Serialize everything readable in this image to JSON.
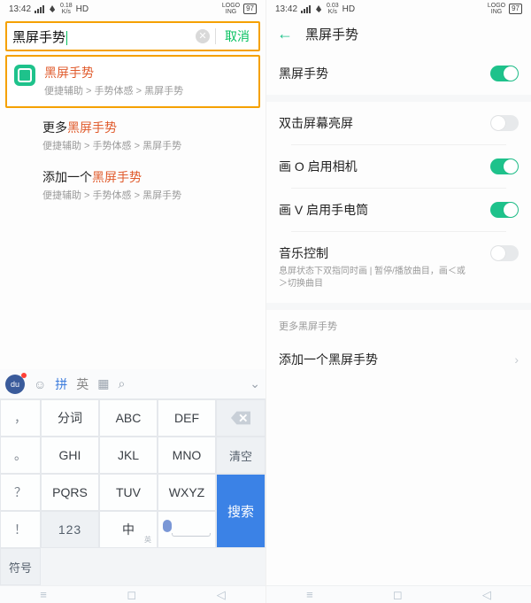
{
  "status": {
    "time": "13:42",
    "net_up": "0.18",
    "net_dn": "K/s",
    "hd": "HD",
    "logo": "LOGO\nING",
    "batt": "97",
    "net_up2": "0.03",
    "net_dn2": "K/s"
  },
  "search": {
    "query": "黑屏手势",
    "cancel": "取消",
    "clear_glyph": "✕"
  },
  "results": [
    {
      "title_pre": "",
      "title_hl": "黑屏手势",
      "title_post": "",
      "path": "便捷辅助 > 手势体感 > 黑屏手势",
      "selected": true,
      "icon": true
    },
    {
      "title_pre": "更多",
      "title_hl": "黑屏手势",
      "title_post": "",
      "path": "便捷辅助 > 手势体感 > 黑屏手势",
      "selected": false,
      "icon": false
    },
    {
      "title_pre": "添加一个",
      "title_hl": "黑屏手势",
      "title_post": "",
      "path": "便捷辅助 > 手势体感 > 黑屏手势",
      "selected": false,
      "icon": false
    }
  ],
  "kbd": {
    "logo": "du",
    "tabs": {
      "pinyin": "拼",
      "english": "英"
    },
    "smile": "☺",
    "mic_top": "🎤",
    "hide": "⌄",
    "grid": {
      "p_comma": "，",
      "fenci": "分词",
      "abc": "ABC",
      "def": "DEF",
      "p_period": "。",
      "ghi": "GHI",
      "jkl": "JKL",
      "mno": "MNO",
      "clear": "清空",
      "p_q": "？",
      "pqrs": "PQRS",
      "tuv": "TUV",
      "wxyz": "WXYZ",
      "search": "搜索",
      "p_ex": "！",
      "num": "123",
      "zh": "中",
      "zh_sub": "英",
      "symbol": "符号"
    }
  },
  "nav": {
    "menu": "≡",
    "home": "◻",
    "back": "◁"
  },
  "right": {
    "title": "黑屏手势",
    "items": {
      "main": "黑屏手势",
      "dbl": "双击屏幕亮屏",
      "drawO": "画 O 启用相机",
      "drawV": "画 V 启用手电筒",
      "music": "音乐控制",
      "music_sub": "息屏状态下双指同时画 | 暂停/播放曲目，画＜或＞切换曲目",
      "more_label": "更多黑屏手势",
      "add": "添加一个黑屏手势"
    },
    "toggles": {
      "main": true,
      "dbl": false,
      "drawO": true,
      "drawV": true,
      "music": false
    }
  }
}
